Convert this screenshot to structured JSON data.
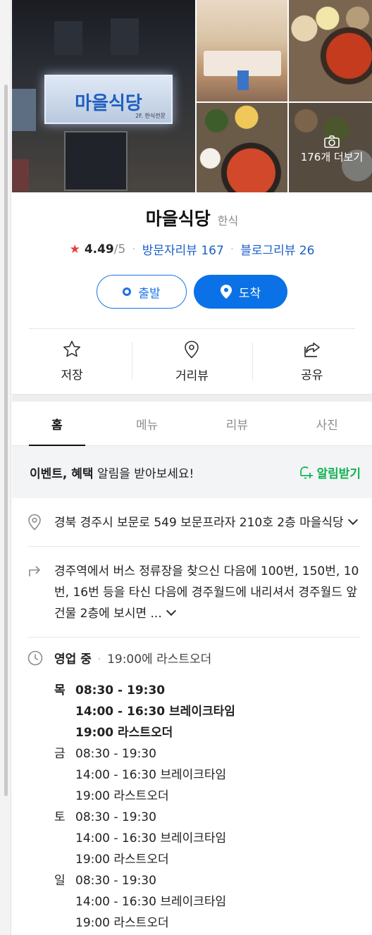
{
  "photos": {
    "more_label": "176개 더보기",
    "sign_name": "마을식당",
    "sign_sub": "2F. 한식전문"
  },
  "place": {
    "name": "마을식당",
    "category": "한식"
  },
  "rating": {
    "score": "4.49",
    "max": "/5",
    "visitor_reviews": "방문자리뷰 167",
    "blog_reviews": "블로그리뷰 26"
  },
  "buttons": {
    "depart": "출발",
    "arrive": "도착"
  },
  "actions": {
    "save": "저장",
    "street_view": "거리뷰",
    "share": "공유"
  },
  "tabs": [
    "홈",
    "메뉴",
    "리뷰",
    "사진"
  ],
  "promo": {
    "bold": "이벤트, 혜택",
    "rest": " 알림을 받아보세요!",
    "button": "알림받기"
  },
  "address": "경북 경주시 보문로 549 보문프라자 210호 2층 마을식당",
  "directions": "경주역에서 버스 정류장을 찾으신 다음에 100번, 150번, 10번, 16번 등을 타신 다음에 경주월드에 내리셔서 경주월드 앞 건물 2층에 보시면 ...",
  "hours": {
    "status": "영업 중",
    "summary": "19:00에 라스트오더",
    "days": [
      {
        "day": "목",
        "hours": "08:30 - 19:30",
        "break": "14:00 - 16:30 브레이크타임",
        "last": "19:00 라스트오더"
      },
      {
        "day": "금",
        "hours": "08:30 - 19:30",
        "break": "14:00 - 16:30 브레이크타임",
        "last": "19:00 라스트오더"
      },
      {
        "day": "토",
        "hours": "08:30 - 19:30",
        "break": "14:00 - 16:30 브레이크타임",
        "last": "19:00 라스트오더"
      },
      {
        "day": "일",
        "hours": "08:30 - 19:30",
        "break": "14:00 - 16:30 브레이크타임",
        "last": "19:00 라스트오더"
      }
    ]
  },
  "colors": {
    "accent": "#0a72e6",
    "link": "#1a5fc8",
    "star": "#ee3a3a",
    "green": "#11b34f"
  }
}
